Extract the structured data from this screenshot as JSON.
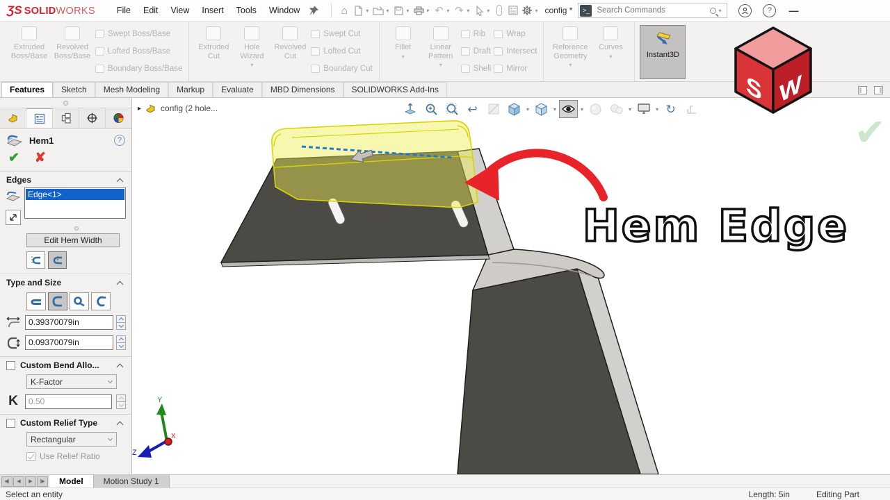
{
  "glyphs": {
    "caret": "▾",
    "expander": "▸",
    "ok": "✔",
    "cancel": "✘",
    "help": "?",
    "minimize": "—",
    "undo": "↶",
    "redo": "↷",
    "rotate": "↻",
    "prev_view": "↩",
    "home": "⌂",
    "cmd_prompt": ">_",
    "faint_check": "✔",
    "nav_first": "◀|",
    "nav_prev": "◀",
    "nav_next": "▶",
    "nav_last": "|▶"
  },
  "window": {
    "brand_mark": "ƷS",
    "brand_solid": "SOLID",
    "brand_works": "WORKS",
    "menus": [
      "File",
      "Edit",
      "View",
      "Insert",
      "Tools",
      "Window"
    ],
    "config_label": "config *",
    "search_placeholder": "Search Commands"
  },
  "ribbon": {
    "g1": {
      "b1": "Extruded Boss/Base",
      "b2": "Revolved Boss/Base",
      "s1": "Swept Boss/Base",
      "s2": "Lofted Boss/Base",
      "s3": "Boundary Boss/Base"
    },
    "g2": {
      "b1": "Extruded Cut",
      "b2": "Hole Wizard",
      "b3": "Revolved Cut",
      "s1": "Swept Cut",
      "s2": "Lofted Cut",
      "s3": "Boundary Cut"
    },
    "g3": {
      "b1": "Fillet",
      "b2": "Linear Pattern",
      "s1": "Rib",
      "s2": "Draft",
      "s3": "Shell",
      "s4": "Wrap",
      "s5": "Intersect",
      "s6": "Mirror"
    },
    "g4": {
      "b1": "Reference Geometry",
      "b2": "Curves"
    },
    "g5": {
      "b1": "Instant3D"
    }
  },
  "tabs": [
    "Features",
    "Sketch",
    "Mesh Modeling",
    "Markup",
    "Evaluate",
    "MBD Dimensions",
    "SOLIDWORKS Add-Ins"
  ],
  "panel": {
    "feature_name": "Hem1",
    "edges": {
      "title": "Edges",
      "selected_edge": "Edge<1>",
      "edit_button": "Edit Hem Width"
    },
    "type_size": {
      "title": "Type and Size",
      "length_value": "0.39370079in",
      "gap_value": "0.09370079in"
    },
    "bend": {
      "title": "Custom Bend Allo...",
      "method": "K-Factor",
      "k_label": "K",
      "k_value": "0.50"
    },
    "relief": {
      "title": "Custom Relief Type",
      "type": "Rectangular",
      "ratio_label": "Use Relief Ratio"
    }
  },
  "viewport": {
    "breadcrumb": "config (2 hole...",
    "annotation": "Hem Edge",
    "cube_s": "S",
    "cube_w": "W",
    "triad": {
      "x": "X",
      "y": "Y",
      "z": "Z"
    }
  },
  "doctabs": {
    "model": "Model",
    "motion": "Motion Study 1"
  },
  "status": {
    "prompt": "Select an entity",
    "length": "Length: 5in",
    "mode": "Editing Part"
  },
  "colors": {
    "selection_blue": "#1262cc",
    "highlight_yellow": "#efec4a",
    "arrow_red": "#e8232a",
    "part_dark": "#4b4a45",
    "part_light": "#d2d0cc",
    "confirm_green": "#2e9e36",
    "cancel_red": "#d43a2f"
  }
}
